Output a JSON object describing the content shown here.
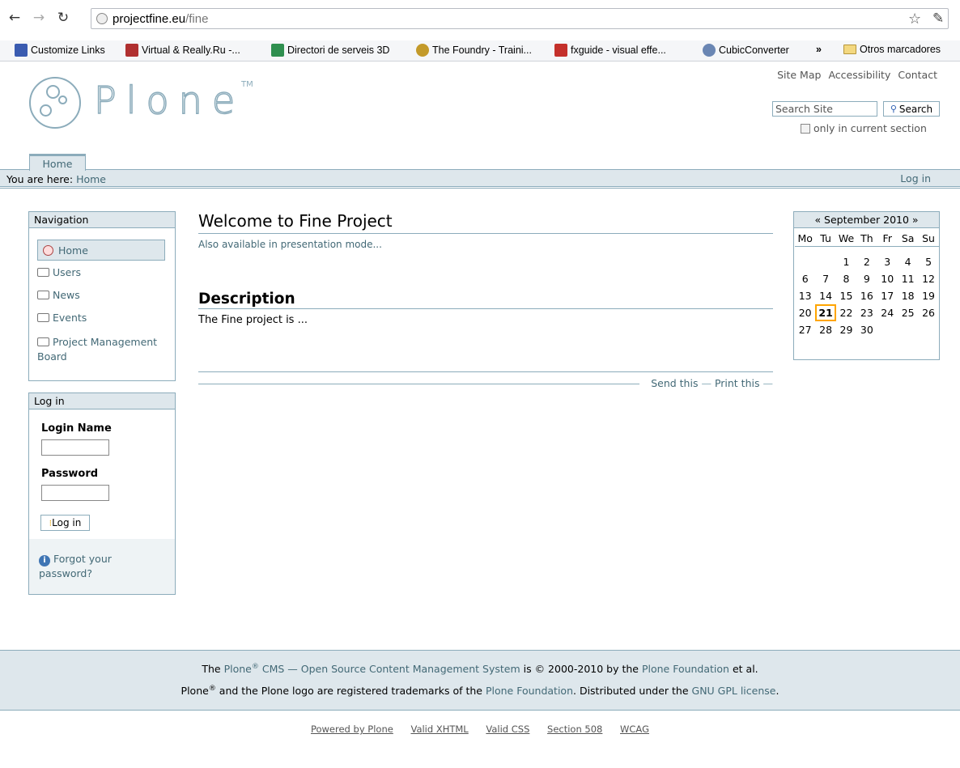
{
  "browser": {
    "url_host": "projectfine.eu",
    "url_path": "/fine",
    "bookmarks": [
      {
        "label": "Customize Links",
        "color": "#3a5bb0"
      },
      {
        "label": "Virtual & Really.Ru -...",
        "color": "#b03030"
      },
      {
        "label": "Directori de serveis 3D",
        "color": "#2f8f4f"
      },
      {
        "label": "The Foundry - Traini...",
        "color": "#c39a2a"
      },
      {
        "label": "fxguide - visual effe...",
        "color": "#c4302b"
      },
      {
        "label": "CubicConverter",
        "color": "#6a86b3"
      }
    ],
    "more": "»",
    "other_bookmarks": "Otros marcadores"
  },
  "site_actions": [
    "Site Map",
    "Accessibility",
    "Contact"
  ],
  "logo": {
    "word": "Plone",
    "tm": "TM"
  },
  "search": {
    "placeholder": "Search Site",
    "button": "Search",
    "option": "only in current section"
  },
  "tabs": {
    "home": "Home"
  },
  "personal": {
    "login": "Log in"
  },
  "breadcrumb": {
    "prefix": "You are here:",
    "home": "Home"
  },
  "navigation": {
    "title": "Navigation",
    "items": [
      "Home",
      "Users",
      "News",
      "Events",
      "Project Management Board"
    ]
  },
  "login_portlet": {
    "title": "Log in",
    "login_name": "Login Name",
    "password": "Password",
    "button": "Log in",
    "forgot": "Forgot your password?"
  },
  "content": {
    "title": "Welcome to Fine Project",
    "presentation_link": "Also available in presentation mode...",
    "desc_heading": "Description",
    "desc_text": "The Fine project is ...",
    "send": "Send this",
    "print": "Print this"
  },
  "calendar": {
    "header": "« September 2010 »",
    "dow": [
      "Mo",
      "Tu",
      "We",
      "Th",
      "Fr",
      "Sa",
      "Su"
    ],
    "weeks": [
      [
        "",
        "",
        "1",
        "2",
        "3",
        "4",
        "5"
      ],
      [
        "6",
        "7",
        "8",
        "9",
        "10",
        "11",
        "12"
      ],
      [
        "13",
        "14",
        "15",
        "16",
        "17",
        "18",
        "19"
      ],
      [
        "20",
        "21",
        "22",
        "23",
        "24",
        "25",
        "26"
      ],
      [
        "27",
        "28",
        "29",
        "30",
        "",
        "",
        ""
      ]
    ],
    "today": "21"
  },
  "footer": {
    "l1_a": "The",
    "plone": "Plone",
    "reg": "®",
    "cms": "CMS — Open Source Content Management System",
    "l1_b": "is © 2000-2010 by the",
    "foundation": "Plone Foundation",
    "l1_c": "et al.",
    "l2_a": "and the Plone logo are registered trademarks of the",
    "l2_b": ". Distributed under the",
    "gpl": "GNU GPL license",
    "l2_c": "."
  },
  "colophon": [
    "Powered by Plone",
    "Valid XHTML",
    "Valid CSS",
    "Section 508",
    "WCAG"
  ]
}
